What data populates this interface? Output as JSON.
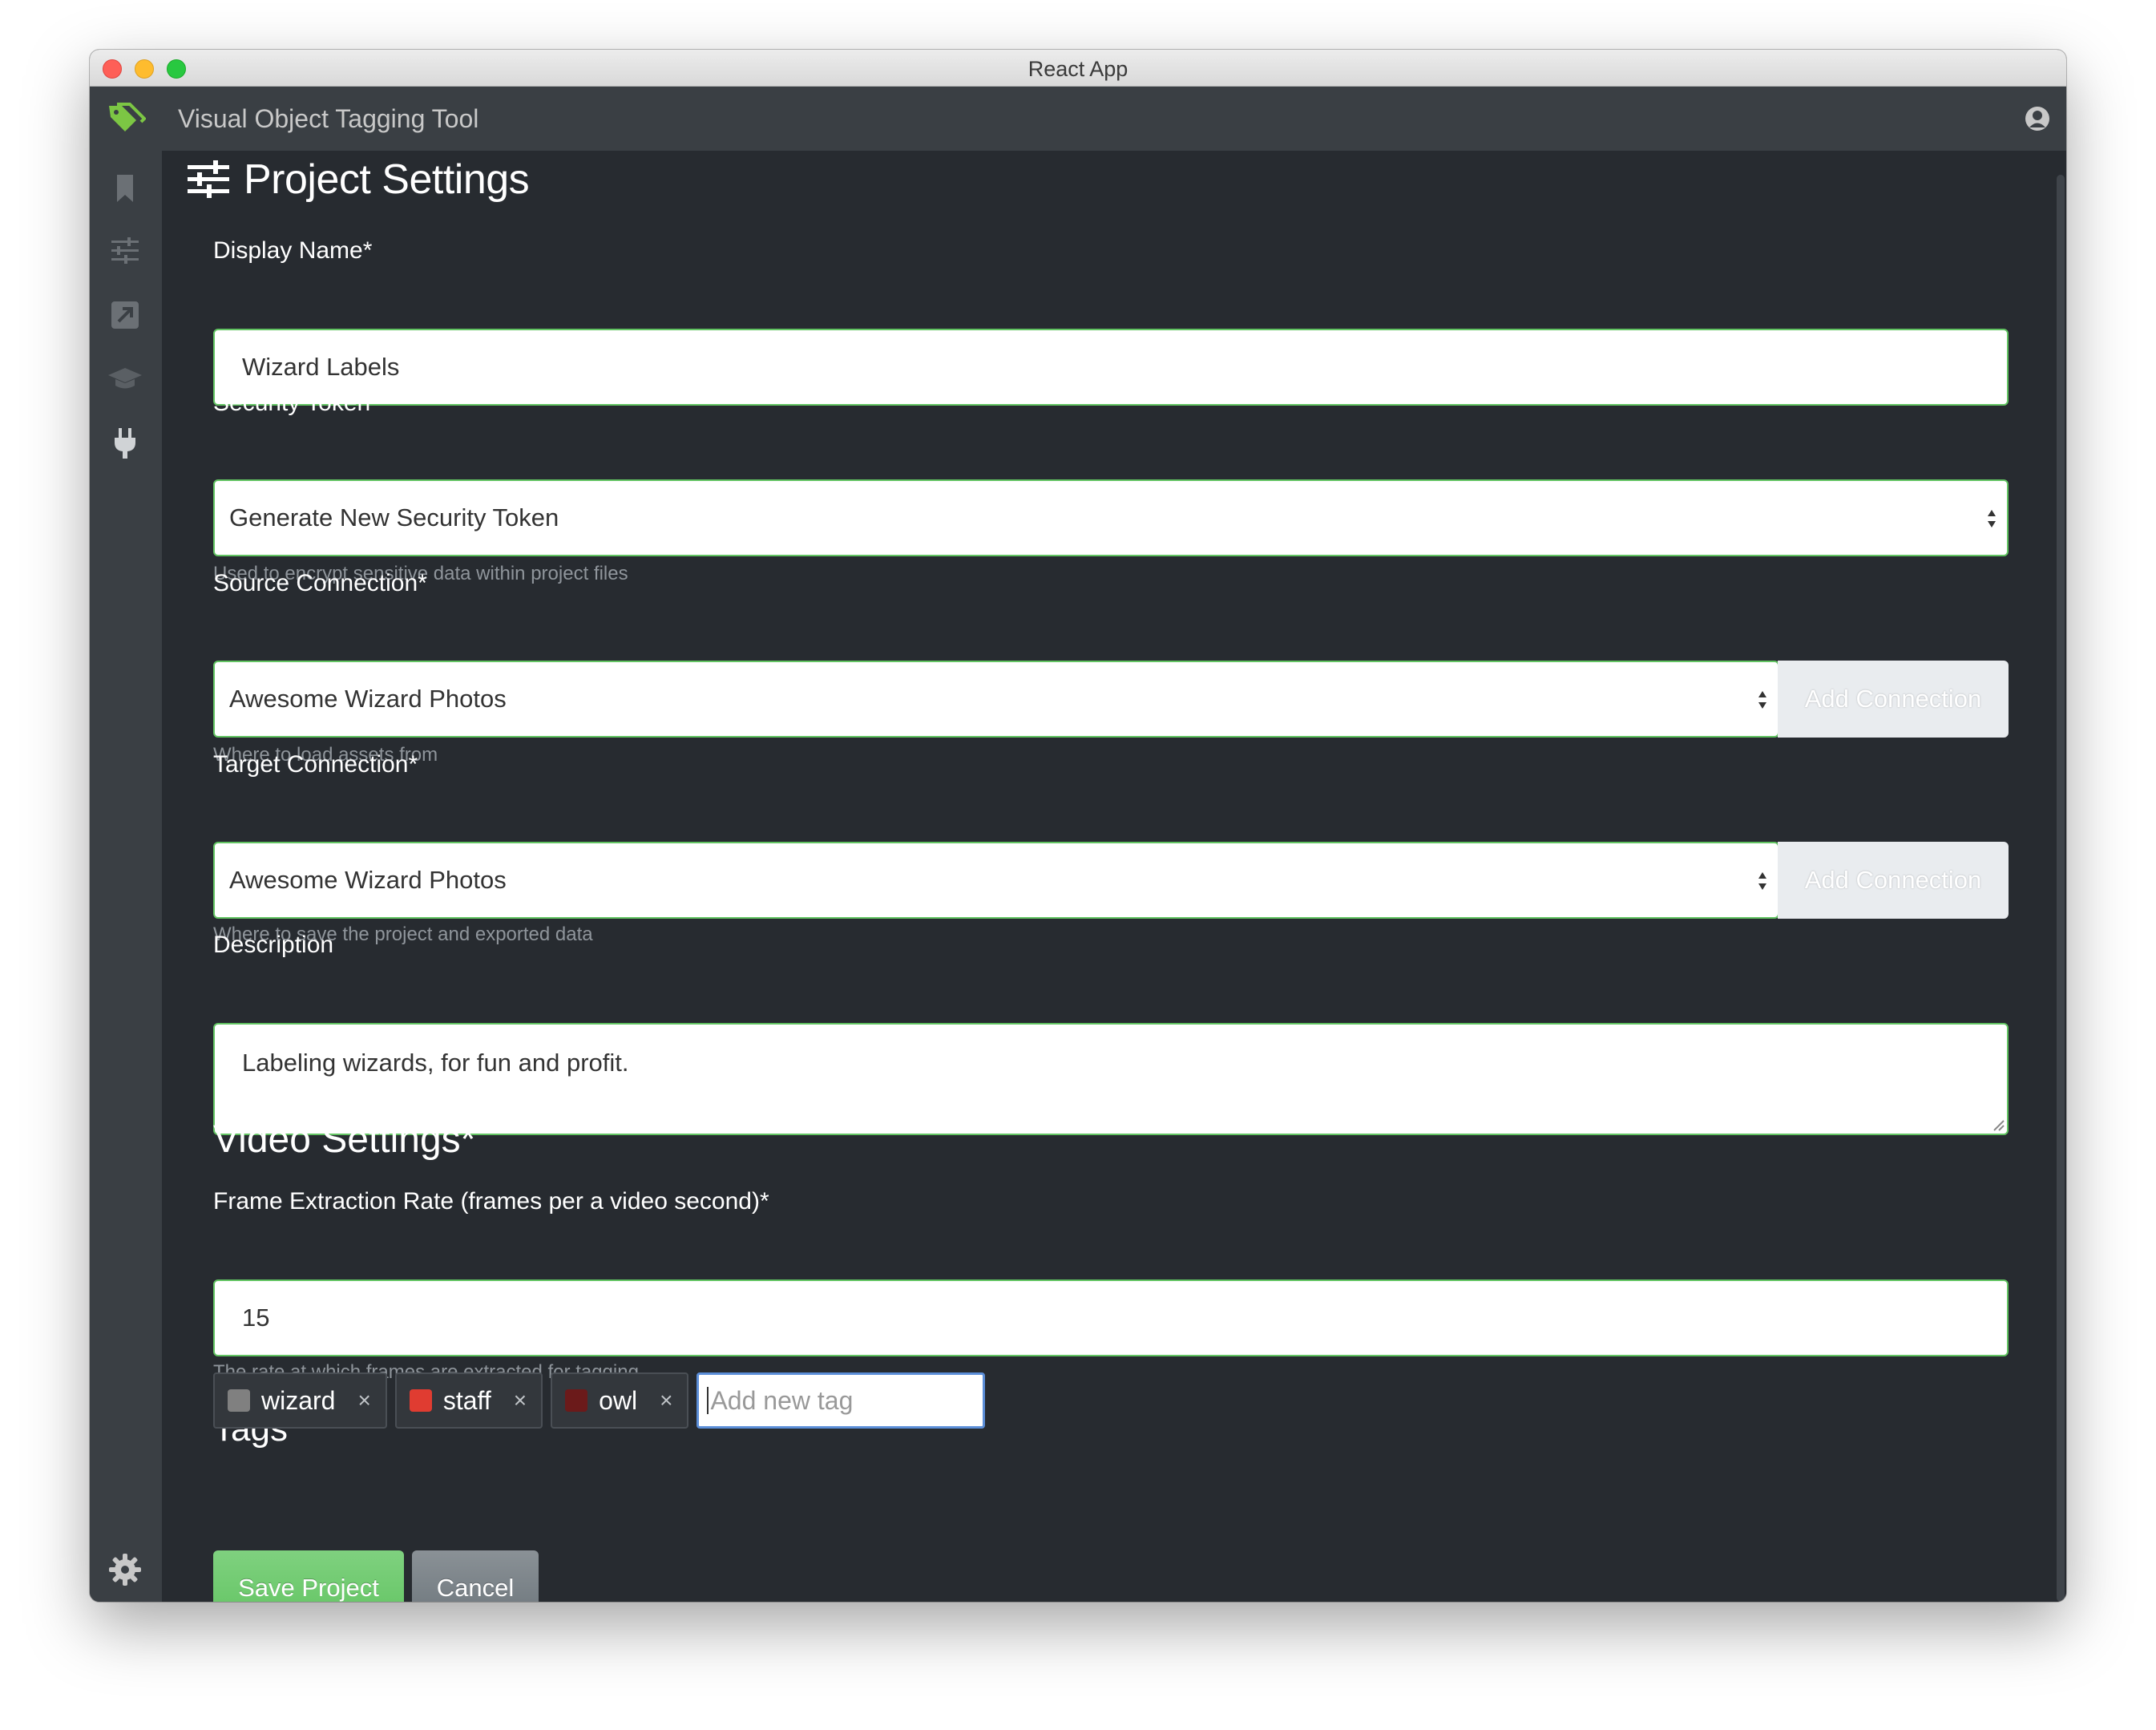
{
  "window": {
    "title": "React App"
  },
  "app": {
    "title": "Visual Object Tagging Tool"
  },
  "sidebar": {
    "items": [
      {
        "icon": "bookmark-icon"
      },
      {
        "icon": "sliders-icon"
      },
      {
        "icon": "export-icon"
      },
      {
        "icon": "graduation-cap-icon"
      },
      {
        "icon": "plug-icon"
      }
    ],
    "bottom_icon": "gear-icon"
  },
  "page": {
    "title": "Project Settings"
  },
  "form": {
    "display_name": {
      "label": "Display Name*",
      "value": "Wizard Labels"
    },
    "security_token": {
      "label": "Security Token",
      "value": "Generate New Security Token",
      "help": "Used to encrypt sensitive data within project files"
    },
    "source_connection": {
      "label": "Source Connection*",
      "value": "Awesome Wizard Photos",
      "button": "Add Connection",
      "help": "Where to load assets from"
    },
    "target_connection": {
      "label": "Target Connection*",
      "value": "Awesome Wizard Photos",
      "button": "Add Connection",
      "help": "Where to save the project and exported data"
    },
    "description": {
      "label": "Description",
      "value": "Labeling wizards, for fun and profit."
    }
  },
  "video": {
    "title": "Video Settings*",
    "frame_rate": {
      "label": "Frame Extraction Rate (frames per a video second)*",
      "value": "15",
      "help": "The rate at which frames are extracted for tagging."
    }
  },
  "tags": {
    "title": "Tags",
    "items": [
      {
        "name": "wizard",
        "color": "#808080"
      },
      {
        "name": "staff",
        "color": "#e03c31"
      },
      {
        "name": "owl",
        "color": "#6b1a1a"
      }
    ],
    "remove_glyph": "×",
    "input_placeholder": "Add new tag"
  },
  "actions": {
    "save": "Save Project",
    "cancel": "Cancel"
  },
  "colors": {
    "background": "#272b30",
    "sidebar": "#3a3f44",
    "accent_green": "#62c462",
    "focus_blue": "#5b8ed8"
  }
}
